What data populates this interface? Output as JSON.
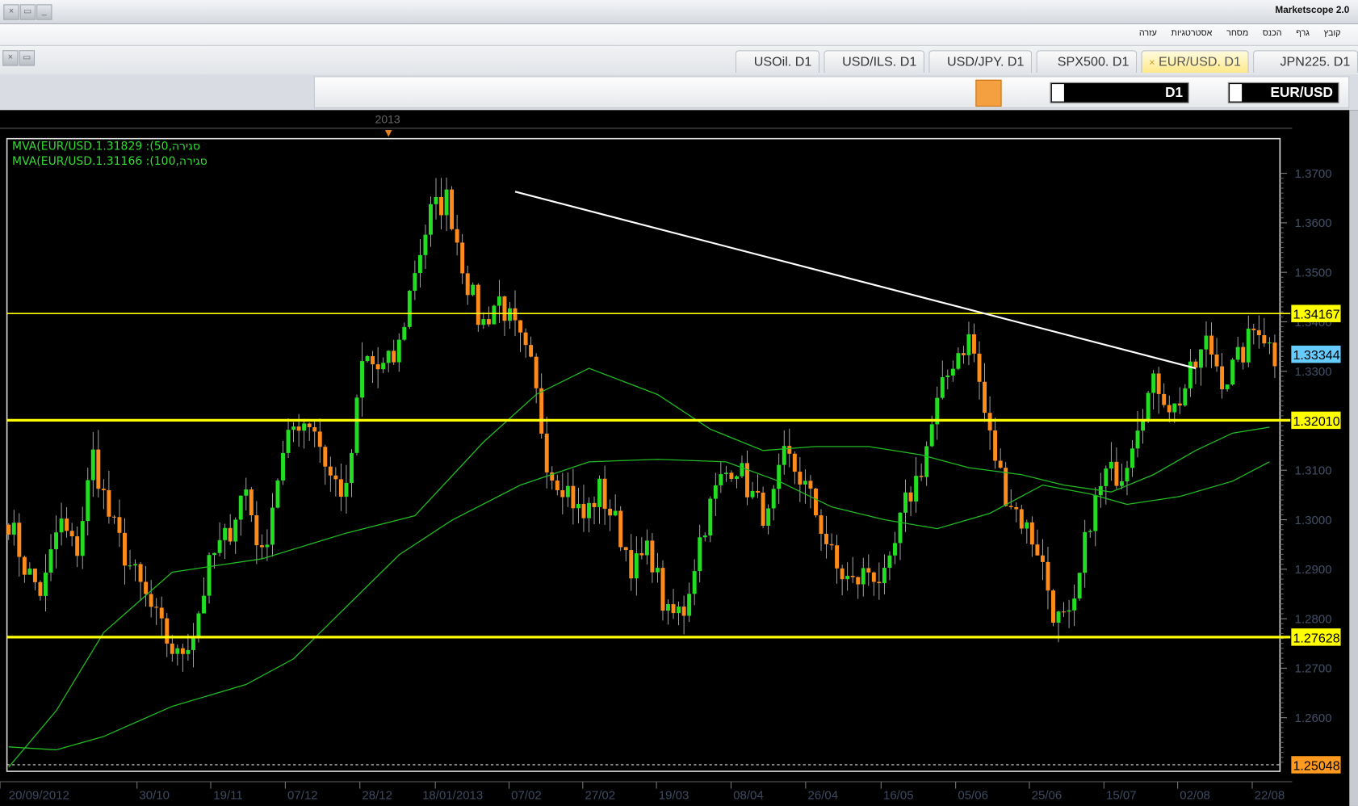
{
  "window": {
    "title": "Marketscope 2.0"
  },
  "menu": [
    "קובץ",
    "גרף",
    "הכנס",
    "מסחר",
    "אסטרטגיות",
    "עזרה"
  ],
  "tabs": [
    {
      "label": "USOil. D1",
      "active": false
    },
    {
      "label": "USD/ILS. D1",
      "active": false
    },
    {
      "label": "USD/JPY. D1",
      "active": false
    },
    {
      "label": "SPX500. D1",
      "active": false
    },
    {
      "label": "EUR/USD. D1",
      "active": true
    },
    {
      "label": "JPN225. D1",
      "active": false
    }
  ],
  "toolbar": {
    "icons": [
      "toolbar-grip-icon",
      "indicators-icon",
      "eraser-icon",
      "text-label-icon",
      "ellipse-icon",
      "line-icon",
      "fibonacci-icon",
      "channels-icon",
      "parallel-lines-icon",
      "window-icon",
      "image-icon",
      "ruler-icon",
      "globe-icon",
      "link-icon",
      "edit-chart-icon",
      "cursor-vertical-icon",
      "zoom-icon",
      "pointer-icon",
      "zoom-in-icon",
      "zoom-out-icon",
      "list-icon",
      "ab-icon",
      "chart-type-icon",
      "close-position-icon"
    ],
    "timeframe": "D1",
    "instrument": "EUR/USD"
  },
  "chart": {
    "year_marker": "2013",
    "legend": [
      "MVA(EUR/USD.1.31829 :(50,סגירה",
      "MVA(EUR/USD.1.31166 :(100,סגירה"
    ],
    "colors": {
      "up": "#22dd22",
      "down": "#ff8c1a",
      "ma": "#22bb22",
      "level": "#ffff00",
      "current": "#66ccff",
      "trend": "#ffffff"
    },
    "y_ticks": [
      "1.3700",
      "1.3600",
      "1.3500",
      "1.3400",
      "1.3300",
      "1.3200",
      "1.3100",
      "1.3000",
      "1.2900",
      "1.2800",
      "1.2700",
      "1.2600"
    ],
    "y_range": [
      1.2479,
      1.3832
    ],
    "x_ticks": [
      "20/09/2012",
      "30/10",
      "19/11",
      "07/12",
      "28/12",
      "18/01/2013",
      "07/02",
      "27/02",
      "19/03",
      "08/04",
      "26/04",
      "16/05",
      "05/06",
      "25/06",
      "15/07",
      "02/08",
      "22/08"
    ],
    "levels": [
      {
        "value": 1.34167,
        "label": "1.34167",
        "style": "thin"
      },
      {
        "value": 1.3201,
        "label": "1.32010",
        "style": "thick"
      },
      {
        "value": 1.27628,
        "label": "1.27628",
        "style": "thick"
      },
      {
        "value": 1.25048,
        "label": "1.25048",
        "style": "dashed"
      }
    ],
    "current_price": {
      "value": 1.33344,
      "label": "1.33344"
    },
    "bars": 241,
    "trendline": {
      "from": [
        96,
        1.3663
      ],
      "to": [
        225,
        1.3306
      ]
    },
    "close_keys": [
      1.3,
      1.29,
      1.285,
      1.3,
      1.293,
      1.313,
      1.3,
      1.292,
      1.285,
      1.278,
      1.272,
      1.278,
      1.292,
      1.297,
      1.307,
      1.292,
      1.31,
      1.32,
      1.32,
      1.309,
      1.305,
      1.333,
      1.33,
      1.333,
      1.35,
      1.362,
      1.365,
      1.35,
      1.339,
      1.345,
      1.338,
      1.33,
      1.31,
      1.307,
      1.3,
      1.306,
      1.299,
      1.29,
      1.294,
      1.28,
      1.282,
      1.297,
      1.307,
      1.312,
      1.305,
      1.3,
      1.313,
      1.308,
      1.3,
      1.29,
      1.287,
      1.29,
      1.287,
      1.302,
      1.31,
      1.323,
      1.333,
      1.337,
      1.318,
      1.306,
      1.3,
      1.294,
      1.28,
      1.279,
      1.3,
      1.309,
      1.31,
      1.322,
      1.328,
      1.322,
      1.329,
      1.336,
      1.328,
      1.333,
      1.34,
      1.333
    ],
    "ma50": {
      "bars": [
        0,
        9,
        18,
        31,
        48,
        64,
        77,
        90,
        100,
        110,
        123,
        133,
        143,
        153,
        163,
        173,
        182,
        192,
        200,
        209,
        217,
        225,
        232,
        239
      ],
      "values": [
        1.25,
        1.2614,
        1.2772,
        1.2894,
        1.2921,
        1.2973,
        1.3008,
        1.3157,
        1.3253,
        1.3306,
        1.3253,
        1.3183,
        1.314,
        1.3148,
        1.3148,
        1.3131,
        1.3105,
        1.3091,
        1.307,
        1.3056,
        1.3091,
        1.314,
        1.3175,
        1.3187
      ]
    },
    "ma100": {
      "bars": [
        0,
        9,
        18,
        31,
        45,
        54,
        64,
        74,
        84,
        97,
        110,
        123,
        136,
        146,
        156,
        166,
        176,
        186,
        196,
        205,
        212,
        222,
        232,
        239
      ],
      "values": [
        1.2541,
        1.2535,
        1.2562,
        1.2623,
        1.2667,
        1.2719,
        1.2824,
        1.2929,
        1.2999,
        1.307,
        1.3117,
        1.3122,
        1.3117,
        1.3078,
        1.3026,
        1.3,
        1.2982,
        1.3013,
        1.307,
        1.3052,
        1.3031,
        1.3047,
        1.3078,
        1.3117
      ]
    }
  }
}
